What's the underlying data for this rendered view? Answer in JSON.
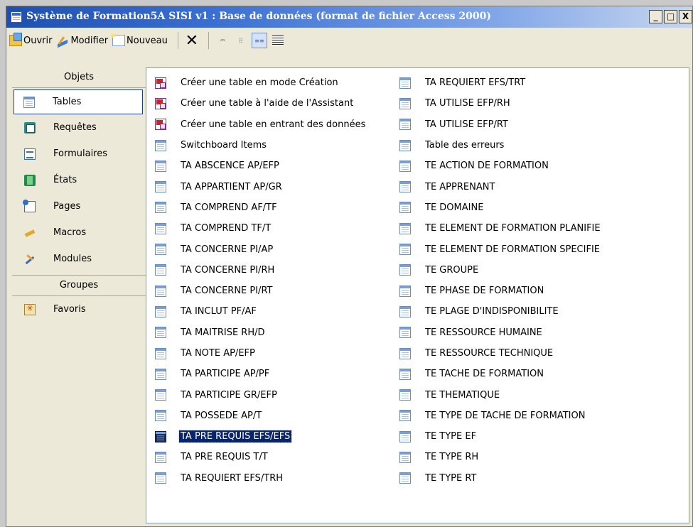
{
  "window": {
    "title": "Système de Formation5A SISI v1 : Base de données (format de fichier Access 2000)",
    "controls": {
      "minimize": "_",
      "maximize": "□",
      "close": "X"
    }
  },
  "toolbar": {
    "open_label": "Ouvrir",
    "edit_label": "Modifier",
    "new_label": "Nouveau",
    "delete_icon": "✕",
    "large_icons_icon": "large-icons-view",
    "small_icons_icon": "small-icons-view",
    "list_icon": "list-view",
    "details_icon": "details-view"
  },
  "sidebar": {
    "objects_header": "Objets",
    "items": [
      {
        "label": "Tables",
        "icon": "table-icon",
        "selected": true
      },
      {
        "label": "Requêtes",
        "icon": "query-icon"
      },
      {
        "label": "Formulaires",
        "icon": "form-icon"
      },
      {
        "label": "États",
        "icon": "report-icon"
      },
      {
        "label": "Pages",
        "icon": "page-icon"
      },
      {
        "label": "Macros",
        "icon": "macro-icon"
      },
      {
        "label": "Modules",
        "icon": "module-icon"
      }
    ],
    "groups_header": "Groupes",
    "groups": [
      {
        "label": "Favoris",
        "icon": "favorites-icon"
      }
    ]
  },
  "list": {
    "column1": [
      "Créer une table en mode Création",
      "Créer une table à l'aide de l'Assistant",
      "Créer une table en entrant des données",
      "Switchboard Items",
      "TA ABSCENCE AP/EFP",
      "TA APPARTIENT AP/GR",
      "TA COMPREND AF/TF",
      "TA COMPREND TF/T",
      "TA CONCERNE PI/AP",
      "TA CONCERNE PI/RH",
      "TA CONCERNE PI/RT",
      "TA INCLUT PF/AF",
      "TA MAITRISE RH/D",
      "TA NOTE AP/EFP",
      "TA PARTICIPE AP/PF",
      "TA PARTICIPE GR/EFP",
      "TA POSSEDE AP/T",
      "TA PRE REQUIS EFS/EFS",
      "TA PRE REQUIS T/T",
      "TA REQUIERT EFS/TRH"
    ],
    "column2": [
      "TA REQUIERT EFS/TRT",
      "TA UTILISE EFP/RH",
      "TA UTILISE EFP/RT",
      "Table des erreurs",
      "TE ACTION DE FORMATION",
      "TE APPRENANT",
      "TE DOMAINE",
      "TE ELEMENT DE FORMATION PLANIFIE",
      "TE ELEMENT DE FORMATION SPECIFIE",
      "TE GROUPE",
      "TE PHASE DE FORMATION",
      "TE PLAGE D'INDISPONIBILITE",
      "TE RESSOURCE HUMAINE",
      "TE RESSOURCE TECHNIQUE",
      "TE TACHE DE FORMATION",
      "TE THEMATIQUE",
      "TE TYPE DE TACHE DE FORMATION",
      "TE TYPE EF",
      "TE TYPE RH",
      "TE TYPE RT"
    ],
    "selected_item": "TA PRE REQUIS EFS/EFS"
  },
  "colors": {
    "titlebar_start": "#1e4fb0",
    "selection": "#0a246a",
    "window_bg": "#ece9d8"
  }
}
